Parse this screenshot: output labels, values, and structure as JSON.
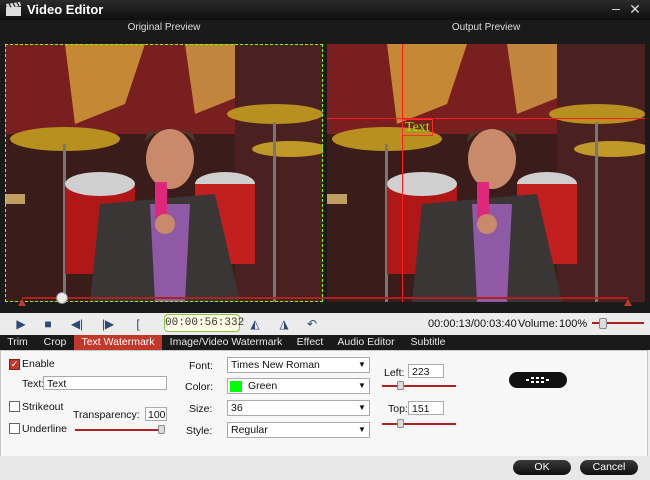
{
  "window": {
    "title": "Video Editor",
    "minimize_glyph": "–",
    "close_glyph": "✕"
  },
  "preview": {
    "original_label": "Original Preview",
    "output_label": "Output Preview",
    "watermark_preview_text": "Text"
  },
  "playback": {
    "time": "00:00:56:332",
    "position": "00:00:13/00:03:40",
    "volume_label": "Volume:",
    "volume_value": "100%",
    "timeline_position": 0.066,
    "volume_fraction": 0.2
  },
  "tabs": [
    {
      "label": "Trim",
      "active": false
    },
    {
      "label": "Crop",
      "active": false
    },
    {
      "label": "Text Watermark",
      "active": true
    },
    {
      "label": "Image/Video Watermark",
      "active": false
    },
    {
      "label": "Effect",
      "active": false
    },
    {
      "label": "Audio Editor",
      "active": false
    },
    {
      "label": "Subtitle",
      "active": false
    }
  ],
  "text_watermark": {
    "enable_label": "Enable",
    "enable_checked": true,
    "text_label": "Text:",
    "text_value": "Text",
    "strikeout_label": "Strikeout",
    "strikeout_checked": false,
    "underline_label": "Underline",
    "underline_checked": false,
    "transparency_label": "Transparency:",
    "transparency_value": "100",
    "font_label": "Font:",
    "font_value": "Times New Roman",
    "color_label": "Color:",
    "color_value": "Green",
    "color_hex": "#00ff00",
    "size_label": "Size:",
    "size_value": "36",
    "style_label": "Style:",
    "style_value": "Regular",
    "left_label": "Left:",
    "left_value": "223",
    "top_label": "Top:",
    "top_value": "151"
  },
  "footer": {
    "ok_label": "OK",
    "cancel_label": "Cancel"
  },
  "colors": {
    "accent": "#c0392b",
    "bar": "#1a1a1a"
  }
}
